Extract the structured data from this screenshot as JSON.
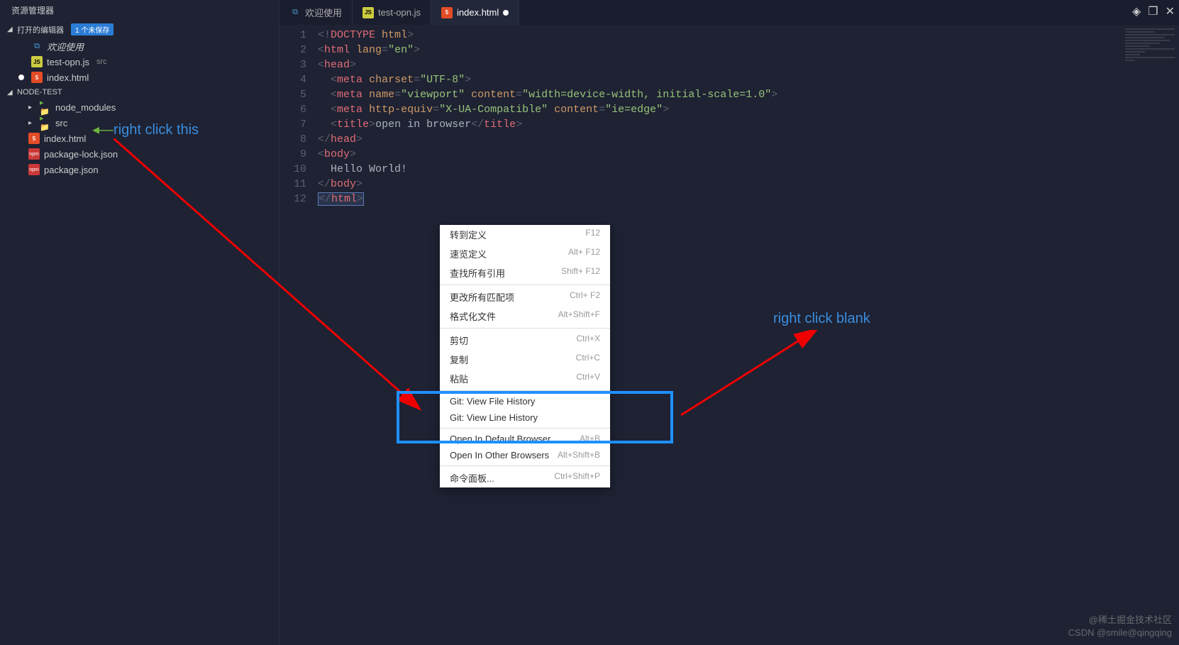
{
  "sidebar": {
    "title": "资源管理器",
    "open_editors_label": "打开的编辑器",
    "unsaved_badge": "1 个未保存",
    "open_editors": [
      {
        "icon": "vscode",
        "label": "欢迎使用",
        "italic": true
      },
      {
        "icon": "js",
        "label": "test-opn.js",
        "hint": "src"
      },
      {
        "icon": "html",
        "label": "index.html",
        "dirty": true
      }
    ],
    "project_label": "NODE-TEST",
    "tree": [
      {
        "type": "folder",
        "label": "node_modules"
      },
      {
        "type": "folder",
        "label": "src"
      },
      {
        "type": "html",
        "label": "index.html"
      },
      {
        "type": "npm",
        "label": "package-lock.json"
      },
      {
        "type": "npm",
        "label": "package.json"
      }
    ]
  },
  "tabs": [
    {
      "icon": "vscode",
      "label": "欢迎使用"
    },
    {
      "icon": "js",
      "label": "test-opn.js"
    },
    {
      "icon": "html",
      "label": "index.html",
      "active": true,
      "dirty": true
    }
  ],
  "code": {
    "lines": [
      {
        "n": "1",
        "html": "<span class='c-gray'>&lt;!</span><span class='c-red'>DOCTYPE</span> <span class='c-orange'>html</span><span class='c-gray'>&gt;</span>"
      },
      {
        "n": "2",
        "html": "<span class='c-gray'>&lt;</span><span class='c-red'>html</span> <span class='c-orange'>lang</span><span class='c-gray'>=</span><span class='c-green'>\"en\"</span><span class='c-gray'>&gt;</span>"
      },
      {
        "n": "3",
        "html": "<span class='c-gray'>&lt;</span><span class='c-red'>head</span><span class='c-gray'>&gt;</span>"
      },
      {
        "n": "4",
        "html": "  <span class='c-gray'>&lt;</span><span class='c-red'>meta</span> <span class='c-orange'>charset</span><span class='c-gray'>=</span><span class='c-green'>\"UTF-8\"</span><span class='c-gray'>&gt;</span>"
      },
      {
        "n": "5",
        "html": "  <span class='c-gray'>&lt;</span><span class='c-red'>meta</span> <span class='c-orange'>name</span><span class='c-gray'>=</span><span class='c-green'>\"viewport\"</span> <span class='c-orange'>content</span><span class='c-gray'>=</span><span class='c-green'>\"width=device-width, initial-scale=1.0\"</span><span class='c-gray'>&gt;</span>"
      },
      {
        "n": "6",
        "html": "  <span class='c-gray'>&lt;</span><span class='c-red'>meta</span> <span class='c-orange'>http-equiv</span><span class='c-gray'>=</span><span class='c-green'>\"X-UA-Compatible\"</span> <span class='c-orange'>content</span><span class='c-gray'>=</span><span class='c-green'>\"ie=edge\"</span><span class='c-gray'>&gt;</span>"
      },
      {
        "n": "7",
        "html": "  <span class='c-gray'>&lt;</span><span class='c-red'>title</span><span class='c-gray'>&gt;</span><span class='c-white'>open in browser</span><span class='c-gray'>&lt;/</span><span class='c-red'>title</span><span class='c-gray'>&gt;</span>"
      },
      {
        "n": "8",
        "html": "<span class='c-gray'>&lt;/</span><span class='c-red'>head</span><span class='c-gray'>&gt;</span>"
      },
      {
        "n": "9",
        "html": "<span class='c-gray'>&lt;</span><span class='c-red'>body</span><span class='c-gray'>&gt;</span>"
      },
      {
        "n": "10",
        "html": "  <span class='c-white'>Hello World!</span>"
      },
      {
        "n": "11",
        "html": "<span class='c-gray'>&lt;/</span><span class='c-red'>body</span><span class='c-gray'>&gt;</span>"
      },
      {
        "n": "12",
        "html": "<span class='cursor-sel'><span class='c-gray'>&lt;/</span><span class='c-red'>html</span><span class='c-gray'>&gt;</span></span>"
      }
    ]
  },
  "context_menu": {
    "groups": [
      [
        {
          "label": "转到定义",
          "shortcut": "F12"
        },
        {
          "label": "速览定义",
          "shortcut": "Alt+ F12"
        },
        {
          "label": "查找所有引用",
          "shortcut": "Shift+ F12"
        }
      ],
      [
        {
          "label": "更改所有匹配项",
          "shortcut": "Ctrl+ F2"
        },
        {
          "label": "格式化文件",
          "shortcut": "Alt+Shift+F"
        }
      ],
      [
        {
          "label": "剪切",
          "shortcut": "Ctrl+X"
        },
        {
          "label": "复制",
          "shortcut": "Ctrl+C"
        },
        {
          "label": "粘贴",
          "shortcut": "Ctrl+V"
        }
      ],
      [
        {
          "label": "Git: View File History",
          "shortcut": ""
        },
        {
          "label": "Git: View Line History",
          "shortcut": ""
        }
      ],
      [
        {
          "label": "Open In Default Browser",
          "shortcut": "Alt+B"
        },
        {
          "label": "Open In Other Browsers",
          "shortcut": "Alt+Shift+B"
        }
      ],
      [
        {
          "label": "命令面板...",
          "shortcut": "Ctrl+Shift+P"
        }
      ]
    ]
  },
  "annotations": {
    "left": "right click this",
    "right": "right click blank"
  },
  "watermark": {
    "line1": "@稀土掘金技术社区",
    "line2": "CSDN @smile@qingqing"
  }
}
